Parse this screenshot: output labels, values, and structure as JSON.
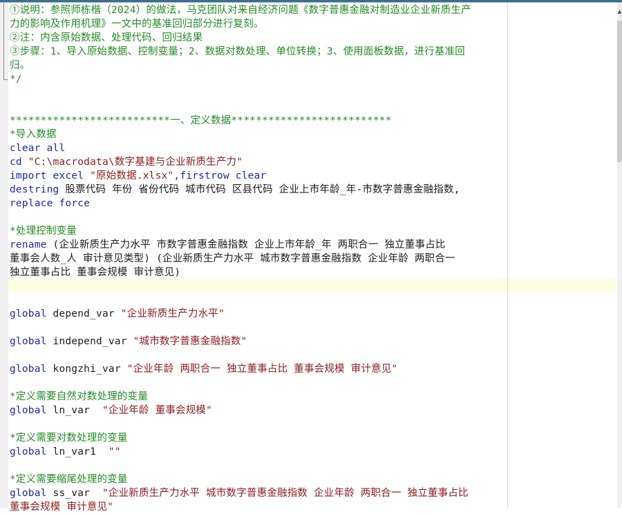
{
  "editor": {
    "colors": {
      "comment": "#228b22",
      "keyword": "#1a2a9e",
      "string": "#8b1a1a",
      "text": "#1a1a1a",
      "current_line": "#fffde0"
    },
    "lines": [
      [
        {
          "t": "c",
          "v": "①说明：参照师栋楷（2024）的做法，马克团队对来自经济问题《数字普惠金融对制造业企业新质生产"
        }
      ],
      [
        {
          "t": "c",
          "v": "力的影响及作用机理》一文中的基准回归部分进行复刻。"
        }
      ],
      [
        {
          "t": "c",
          "v": "②注：内含原始数据、处理代码、回归结果"
        }
      ],
      [
        {
          "t": "c",
          "v": "③步骤：1、导入原始数据、控制变量；2、数据对数处理、单位转换；3、使用面板数据，进行基准回"
        }
      ],
      [
        {
          "t": "c",
          "v": "归。"
        }
      ],
      [
        {
          "t": "c",
          "v": "*/"
        }
      ],
      [],
      [],
      [
        {
          "t": "c",
          "v": "**************************一、定义数据**************************"
        }
      ],
      [
        {
          "t": "c",
          "v": "*导入数据"
        }
      ],
      [
        {
          "t": "k",
          "v": "clear all"
        }
      ],
      [
        {
          "t": "k",
          "v": "cd "
        },
        {
          "t": "s",
          "v": "\"C:\\macrodata\\数字基建与企业新质生产力\""
        }
      ],
      [
        {
          "t": "k",
          "v": "import excel "
        },
        {
          "t": "s",
          "v": "\"原始数据.xlsx\""
        },
        {
          "t": "k",
          "v": ",firstrow clear"
        }
      ],
      [
        {
          "t": "k",
          "v": "destring "
        },
        {
          "t": "t",
          "v": "股票代码 年份 省份代码 城市代码 区县代码 企业上市年龄_年-市数字普惠金融指数,"
        }
      ],
      [
        {
          "t": "k",
          "v": "replace force"
        }
      ],
      [],
      [
        {
          "t": "c",
          "v": "*处理控制变量"
        }
      ],
      [
        {
          "t": "k",
          "v": "rename "
        },
        {
          "t": "t",
          "v": "(企业新质生产力水平 市数字普惠金融指数 企业上市年龄_年 两职合一 独立董事占比"
        }
      ],
      [
        {
          "t": "t",
          "v": "董事会人数_人 审计意见类型) (企业新质生产力水平 城市数字普惠金融指数 企业年龄 两职合一"
        }
      ],
      [
        {
          "t": "t",
          "v": "独立董事占比 董事会规模 审计意见)"
        }
      ],
      [],
      [],
      [
        {
          "t": "k",
          "v": "global "
        },
        {
          "t": "t",
          "v": "depend_var "
        },
        {
          "t": "s",
          "v": "\"企业新质生产力水平\""
        }
      ],
      [],
      [
        {
          "t": "k",
          "v": "global "
        },
        {
          "t": "t",
          "v": "independ_var "
        },
        {
          "t": "s",
          "v": "\"城市数字普惠金融指数\""
        }
      ],
      [],
      [
        {
          "t": "k",
          "v": "global "
        },
        {
          "t": "t",
          "v": "kongzhi_var "
        },
        {
          "t": "s",
          "v": "\"企业年龄 两职合一 独立董事占比 董事会规模 审计意见\""
        }
      ],
      [],
      [
        {
          "t": "c",
          "v": "*定义需要自然对数处理的变量"
        }
      ],
      [
        {
          "t": "k",
          "v": "global "
        },
        {
          "t": "t",
          "v": "ln_var  "
        },
        {
          "t": "s",
          "v": "\"企业年龄 董事会规模\""
        }
      ],
      [],
      [
        {
          "t": "c",
          "v": "*定义需要对数处理的变量"
        }
      ],
      [
        {
          "t": "k",
          "v": "global "
        },
        {
          "t": "t",
          "v": "ln_var1  "
        },
        {
          "t": "s",
          "v": "\"\""
        }
      ],
      [],
      [
        {
          "t": "c",
          "v": "*定义需要缩尾处理的变量"
        }
      ],
      [
        {
          "t": "k",
          "v": "global "
        },
        {
          "t": "t",
          "v": "ss_var  "
        },
        {
          "t": "s",
          "v": "\"企业新质生产力水平 城市数字普惠金融指数 企业年龄 两职合一 独立董事占比"
        }
      ],
      [
        {
          "t": "s",
          "v": "董事会规模 审计意见\""
        }
      ]
    ]
  },
  "scrollbar": {
    "arrow_icon": "▲",
    "position_fraction": 0.04,
    "visible_fraction": 0.28
  }
}
